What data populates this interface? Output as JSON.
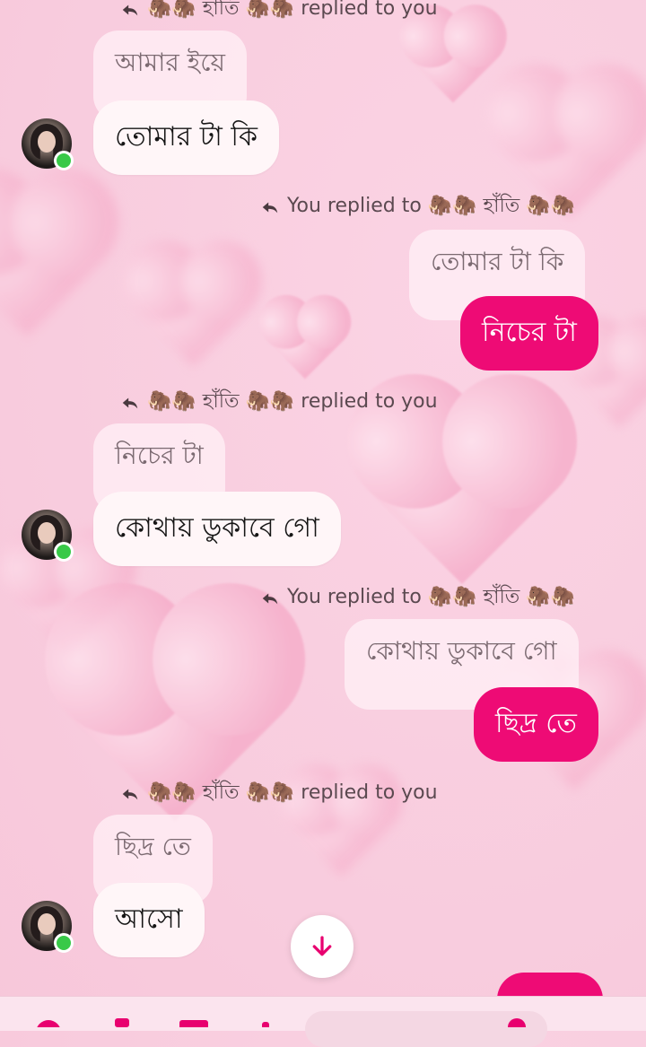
{
  "messages": [
    {
      "direction": "in",
      "reply_header": "🦣🦣 হাঁতি 🦣🦣 replied to you",
      "quoted_text": "আমার ইয়ে",
      "text": "তোমার টা কি",
      "avatar_online": true
    },
    {
      "direction": "out",
      "reply_header": "You replied to 🦣🦣 হাঁতি 🦣🦣",
      "quoted_text": "তোমার টা কি",
      "text": "নিচের টা"
    },
    {
      "direction": "in",
      "reply_header": "🦣🦣 হাঁতি 🦣🦣 replied to you",
      "quoted_text": "নিচের টা",
      "text": "কোথায় ডুকাবে গো",
      "avatar_online": true
    },
    {
      "direction": "out",
      "reply_header": "You replied to 🦣🦣 হাঁতি 🦣🦣",
      "quoted_text": "কোথায় ডুকাবে গো",
      "text": "ছিদ্র তে"
    },
    {
      "direction": "in",
      "reply_header": "🦣🦣 হাঁতি 🦣🦣 replied to you",
      "quoted_text": "ছিদ্র তে",
      "text": "আসো",
      "avatar_online": true
    }
  ],
  "icons": {
    "reply": "reply-arrow-icon",
    "scroll": "arrow-down-icon"
  },
  "colors": {
    "outgoing_bubble": "#ee0b75",
    "incoming_bubble": "#fff6f8",
    "online_dot": "#38c948",
    "accent": "#e8006f"
  }
}
